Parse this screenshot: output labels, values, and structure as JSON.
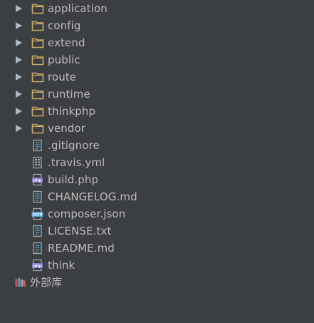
{
  "tree": {
    "folders": [
      {
        "label": "application",
        "icon": "folder-icon"
      },
      {
        "label": "config",
        "icon": "folder-icon"
      },
      {
        "label": "extend",
        "icon": "folder-icon"
      },
      {
        "label": "public",
        "icon": "folder-icon"
      },
      {
        "label": "route",
        "icon": "folder-icon"
      },
      {
        "label": "runtime",
        "icon": "folder-icon"
      },
      {
        "label": "thinkphp",
        "icon": "folder-icon"
      },
      {
        "label": "vendor",
        "icon": "folder-icon"
      }
    ],
    "files": [
      {
        "label": ".gitignore",
        "icon": "text-file-icon"
      },
      {
        "label": ".travis.yml",
        "icon": "yaml-file-icon"
      },
      {
        "label": "build.php",
        "icon": "php-file-icon"
      },
      {
        "label": "CHANGELOG.md",
        "icon": "text-file-icon"
      },
      {
        "label": "composer.json",
        "icon": "json-file-icon"
      },
      {
        "label": "LICENSE.txt",
        "icon": "text-file-icon"
      },
      {
        "label": "README.md",
        "icon": "text-file-icon"
      },
      {
        "label": "think",
        "icon": "php-file-icon"
      }
    ],
    "external_libraries": {
      "label": "外部库",
      "icon": "library-icon"
    }
  },
  "colors": {
    "background": "#3c3f41",
    "text": "#bbbbbb",
    "folder": "#c8a96b",
    "php": "#8c7bd6",
    "json": "#4a9fd8"
  }
}
